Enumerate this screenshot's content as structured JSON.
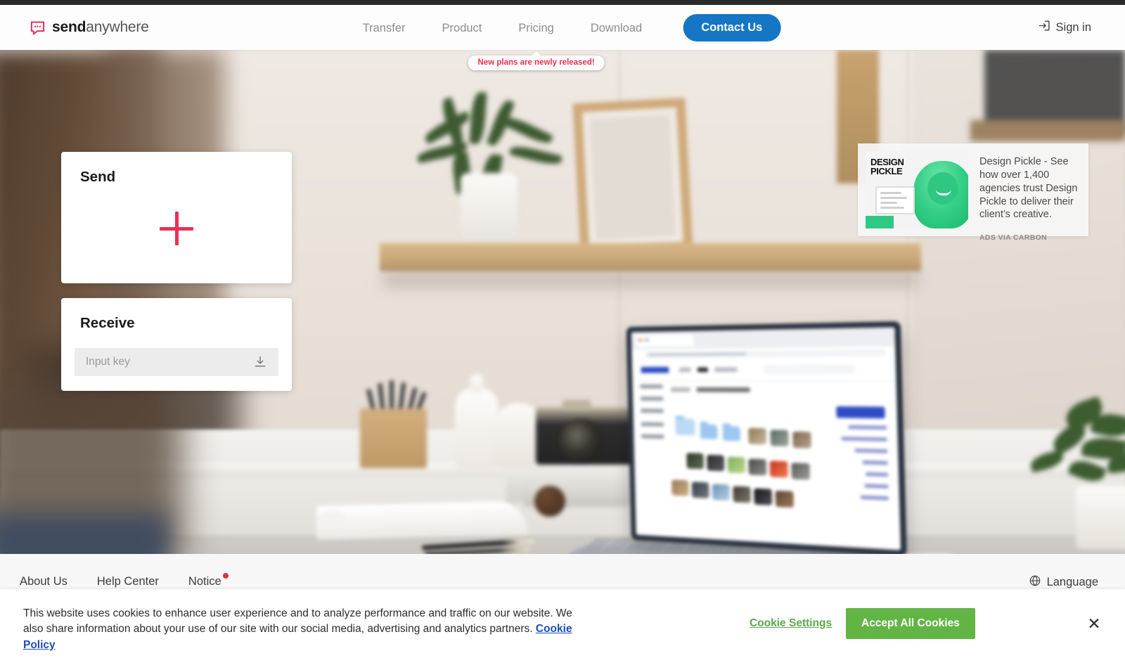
{
  "header": {
    "logo": {
      "bold": "send",
      "light": "anywhere",
      "icon": "sendanywhere-logo-icon"
    },
    "nav": [
      {
        "label": "Transfer",
        "name": "nav-transfer"
      },
      {
        "label": "Product",
        "name": "nav-product"
      },
      {
        "label": "Pricing",
        "name": "nav-pricing"
      },
      {
        "label": "Download",
        "name": "nav-download"
      }
    ],
    "pricing_tooltip": "New plans are newly released!",
    "contact_label": "Contact Us",
    "signin_label": "Sign in",
    "accent_blue": "#1476c4",
    "tooltip_red": "#e8304e"
  },
  "hero": {
    "send": {
      "title": "Send",
      "plus_icon": "plus-icon",
      "accent": "#e8315a"
    },
    "receive": {
      "title": "Receive",
      "input_value": "",
      "input_placeholder": "Input key",
      "download_icon": "download-icon"
    }
  },
  "ad": {
    "brand_line1": "DESIGN",
    "brand_line2": "PICKLE",
    "text": "Design Pickle - See how over 1,400 agencies trust Design Pickle to deliver their client’s creative.",
    "via": "ADS VIA CARBON"
  },
  "footer": {
    "links": [
      {
        "label": "About Us",
        "name": "footer-about-us"
      },
      {
        "label": "Help Center",
        "name": "footer-help-center"
      },
      {
        "label": "Notice",
        "name": "footer-notice",
        "badge": true
      }
    ],
    "language_label": "Language",
    "language_icon": "globe-icon"
  },
  "cookie_banner": {
    "text": "This website uses cookies to enhance user experience and to analyze performance and traffic on our website. We also share information about your use of our site with our social media, advertising and analytics partners.",
    "policy_link": "Cookie Policy",
    "settings_label": "Cookie Settings",
    "accept_label": "Accept All Cookies",
    "close_icon": "close-icon",
    "accept_color": "#62b445",
    "link_color": "#1b4db8"
  }
}
